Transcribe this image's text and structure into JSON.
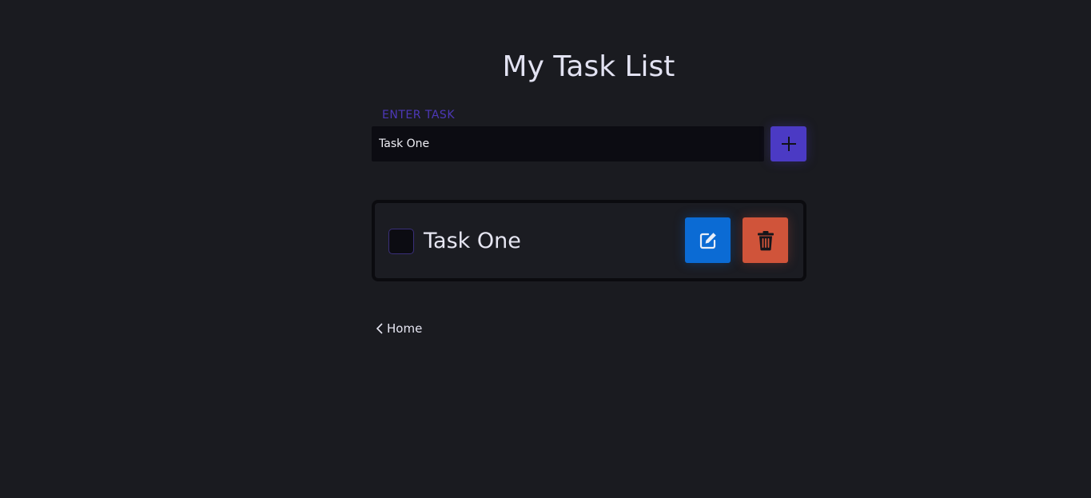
{
  "header": {
    "title": "My Task List"
  },
  "form": {
    "label": "ENTER TASK",
    "input_value": "Task One",
    "add_icon": "plus-icon"
  },
  "tasks": [
    {
      "text": "Task One",
      "checked": false,
      "edit_icon": "pencil-square-icon",
      "delete_icon": "trash-icon"
    }
  ],
  "nav": {
    "home_label": "Home",
    "home_icon": "chevron-left-icon"
  },
  "colors": {
    "background": "#1a1b20",
    "accent": "#4b3ac4",
    "edit": "#0b6bd4",
    "delete": "#d0543a"
  }
}
